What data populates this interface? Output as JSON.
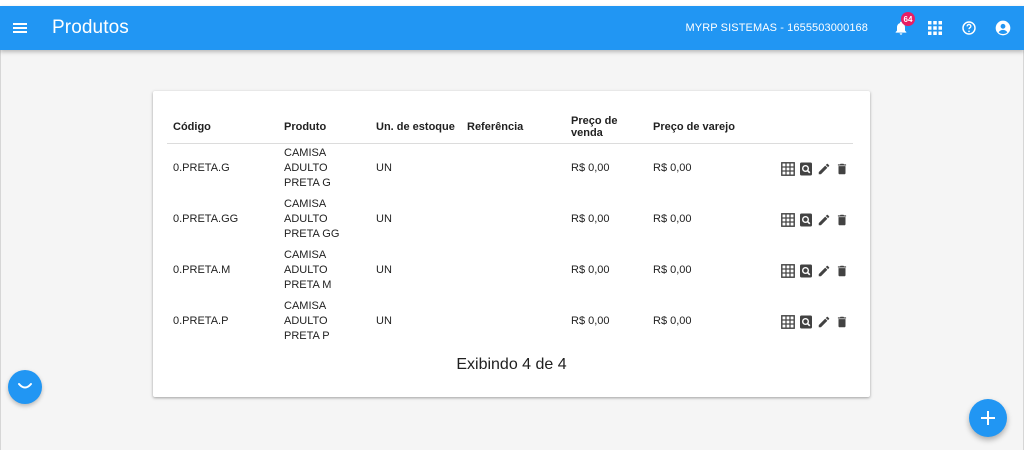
{
  "appbar": {
    "title": "Produtos",
    "company": "MYRP SISTEMAS - 1655503000168",
    "notification_count": "64",
    "menu_icon": "menu-icon",
    "icons": [
      "bell-icon",
      "apps-grid-icon",
      "help-icon",
      "account-icon"
    ]
  },
  "table": {
    "headers": {
      "codigo": "Código",
      "produto": "Produto",
      "un": "Un. de estoque",
      "referencia": "Referência",
      "venda": "Preço de venda",
      "varejo": "Preço de varejo"
    },
    "rows": [
      {
        "codigo": "0.PRETA.G",
        "produto_l1": "CAMISA ADULTO",
        "produto_l2": "PRETA G",
        "un": "UN",
        "referencia": "",
        "venda": "R$ 0,00",
        "varejo": "R$ 0,00"
      },
      {
        "codigo": "0.PRETA.GG",
        "produto_l1": "CAMISA ADULTO",
        "produto_l2": "PRETA GG",
        "un": "UN",
        "referencia": "",
        "venda": "R$ 0,00",
        "varejo": "R$ 0,00"
      },
      {
        "codigo": "0.PRETA.M",
        "produto_l1": "CAMISA ADULTO",
        "produto_l2": "PRETA M",
        "un": "UN",
        "referencia": "",
        "venda": "R$ 0,00",
        "varejo": "R$ 0,00"
      },
      {
        "codigo": "0.PRETA.P",
        "produto_l1": "CAMISA ADULTO",
        "produto_l2": "PRETA P",
        "un": "UN",
        "referencia": "",
        "venda": "R$ 0,00",
        "varejo": "R$ 0,00"
      }
    ],
    "row_action_icons": [
      "grid-table-icon",
      "search-document-icon",
      "edit-pencil-icon",
      "delete-trash-icon"
    ],
    "footer": "Exibindo 4 de 4"
  },
  "colors": {
    "primary": "#2196f3",
    "badge": "#e91e63",
    "background": "#f5f5f5",
    "icon": "#424242"
  }
}
